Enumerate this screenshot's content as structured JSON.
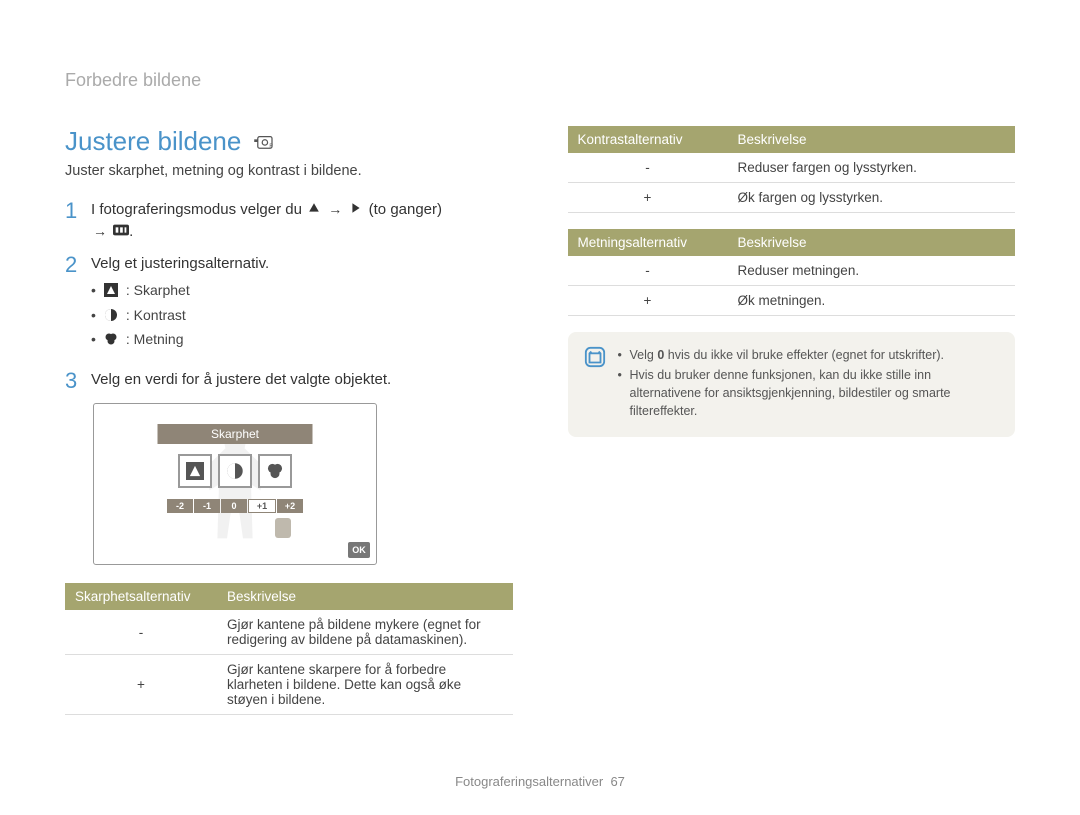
{
  "breadcrumb": "Forbedre bildene",
  "title": "Justere bildene",
  "subtitle": "Juster skarphet, metning og kontrast i bildene.",
  "steps": {
    "s1_a": "I fotograferingsmodus velger du ",
    "s1_b": " (to ganger) ",
    "s2": "Velg et justeringsalternativ.",
    "s3": "Velg en verdi for å justere det valgte objektet."
  },
  "opts": {
    "sharp": ": Skarphet",
    "contrast": ": Kontrast",
    "sat": ": Metning"
  },
  "preview": {
    "label": "Skarphet",
    "scale": [
      "-2",
      "-1",
      "0",
      "+1",
      "+2"
    ],
    "ok": "OK"
  },
  "tbl_sharp": {
    "h1": "Skarphetsalternativ",
    "h2": "Beskrivelse",
    "r1s": "-",
    "r1d": "Gjør kantene på bildene mykere (egnet for redigering av bildene på datamaskinen).",
    "r2s": "+",
    "r2d": "Gjør kantene skarpere for å forbedre klarheten i bildene. Dette kan også øke støyen i bildene."
  },
  "tbl_contrast": {
    "h1": "Kontrastalternativ",
    "h2": "Beskrivelse",
    "r1s": "-",
    "r1d": "Reduser fargen og lysstyrken.",
    "r2s": "+",
    "r2d": "Øk fargen og lysstyrken."
  },
  "tbl_sat": {
    "h1": "Metningsalternativ",
    "h2": "Beskrivelse",
    "r1s": "-",
    "r1d": "Reduser metningen.",
    "r2s": "+",
    "r2d": "Øk metningen."
  },
  "note": {
    "l1a": "Velg ",
    "l1b": "0",
    "l1c": " hvis du ikke vil bruke effekter (egnet for utskrifter).",
    "l2": "Hvis du bruker denne funksjonen, kan du ikke stille inn alternativene for ansiktsgjenkjenning, bildestiler og smarte filtereffekter."
  },
  "footer": {
    "section": "Fotograferingsalternativer",
    "page": "67"
  }
}
